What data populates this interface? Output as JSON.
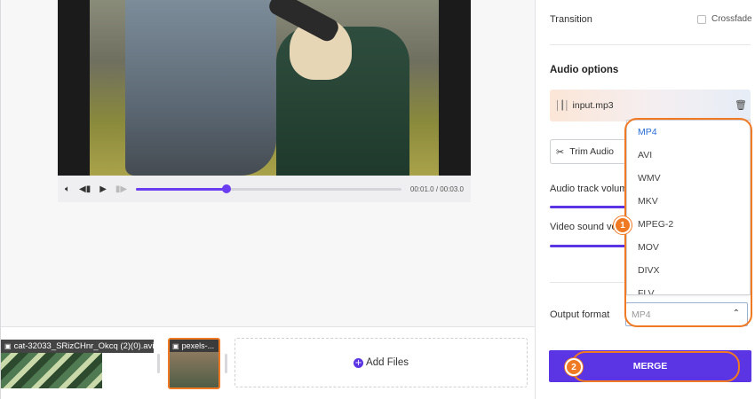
{
  "player": {
    "time_current": "00:01.0",
    "time_total": "00:03.0",
    "separator": "/",
    "progress_fraction": 0.34
  },
  "timeline": {
    "clips": [
      {
        "label": "cat-32033_SRizCHnr_Okcq (2)(0).avi"
      },
      {
        "label": "pexels-..."
      }
    ],
    "add_files_label": "Add Files"
  },
  "settings": {
    "transition_label": "Transition",
    "crossfade_label": "Crossfade",
    "audio_options_title": "Audio options",
    "audio_file_name": "input.mp3",
    "trim_audio_label": "Trim Audio",
    "audio_track_volume_label": "Audio track volume",
    "video_sound_volume_label": "Video sound volume",
    "output_format_label": "Output format",
    "output_format_value": "MP4"
  },
  "format_dropdown": {
    "options": [
      "MP4",
      "AVI",
      "WMV",
      "MKV",
      "MPEG-2",
      "MOV",
      "DIVX",
      "FLV"
    ],
    "selected": "MP4"
  },
  "merge_label": "MERGE",
  "annotations": {
    "badge1": "1",
    "badge2": "2"
  },
  "colors": {
    "accent": "#5b34e3",
    "highlight": "#f07a24",
    "selected_option": "#2a6fd6"
  },
  "icons": [
    "volume-icon",
    "rewind-icon",
    "play-icon",
    "skip-icon",
    "video-file-icon",
    "image-file-icon",
    "plus-icon",
    "waveform-icon",
    "trash-icon",
    "scissors-icon",
    "chevron-up-icon"
  ]
}
